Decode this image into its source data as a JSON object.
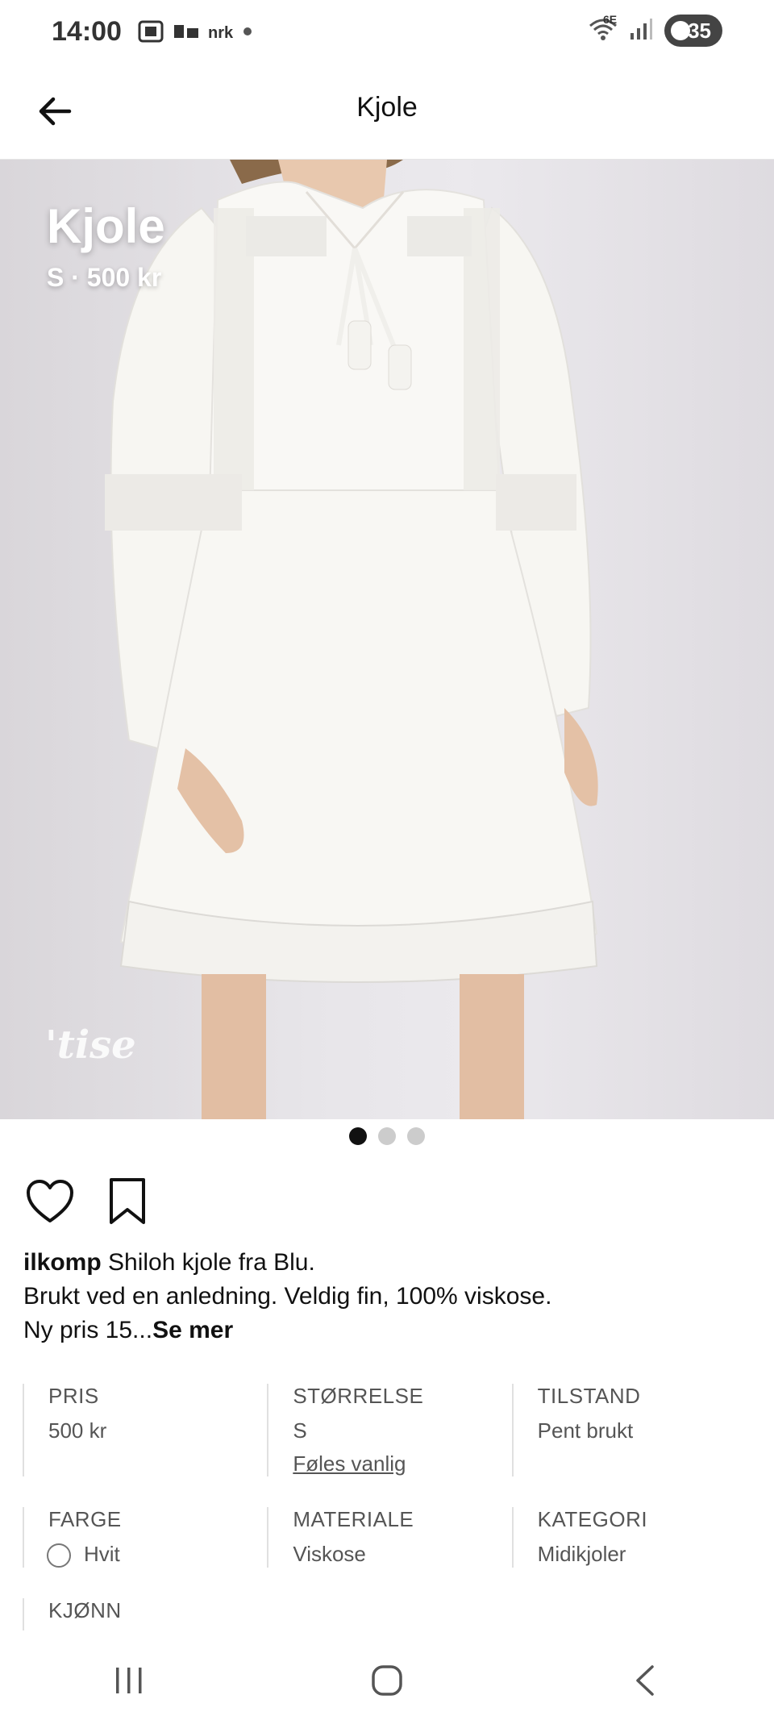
{
  "status_bar": {
    "time": "14:00",
    "left_icons": [
      "screenshot-icon",
      "notification-icon",
      "nrk-app-icon"
    ],
    "nrk_label": "nrk",
    "network_label": "6E",
    "battery_level": "35"
  },
  "app_bar": {
    "title": "Kjole",
    "back_icon": "arrow-left-icon"
  },
  "image": {
    "overlay_title": "Kjole",
    "overlay_subtitle": "S · 500 kr",
    "watermark": "tise",
    "carousel_count": 3,
    "carousel_active": 0
  },
  "actions": {
    "like_icon": "heart-icon",
    "save_icon": "bookmark-icon"
  },
  "description": {
    "username": "ilkomp",
    "line1": " Shiloh kjole fra Blu.",
    "line2": "Brukt ved en anledning.  Veldig fin, 100% viskose.",
    "line3": "Ny pris 15...",
    "see_more": "Se mer"
  },
  "attributes": {
    "price": {
      "label": "PRIS",
      "value": "500 kr"
    },
    "size": {
      "label": "STØRRELSE",
      "value": "S",
      "link": "Føles vanlig"
    },
    "condition": {
      "label": "TILSTAND",
      "value": "Pent brukt"
    },
    "color": {
      "label": "FARGE",
      "value": "Hvit",
      "swatch": "#ffffff"
    },
    "material": {
      "label": "MATERIALE",
      "value": "Viskose"
    },
    "category": {
      "label": "KATEGORI",
      "value": "Midikjoler"
    },
    "gender": {
      "label": "KJØNN"
    }
  },
  "nav_bar": {
    "recents_icon": "recents-icon",
    "home_icon": "home-icon",
    "back_icon": "back-chevron-icon"
  }
}
